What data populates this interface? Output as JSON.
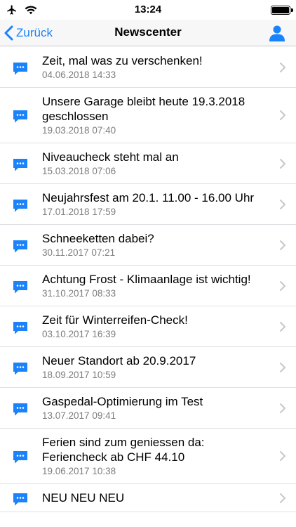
{
  "status_bar": {
    "time": "13:24",
    "icons": [
      "airplane-icon",
      "wifi-icon",
      "battery-icon"
    ],
    "battery_level": 1.0
  },
  "nav": {
    "back_label": "Zurück",
    "title": "Newscenter",
    "right_icon": "profile-icon"
  },
  "colors": {
    "accent": "#1a82fb",
    "secondary_text": "#7d7d82",
    "separator": "#e0e0e4",
    "nav_background": "#f7f7f7"
  },
  "news": [
    {
      "title": "Zeit, mal was zu verschenken!",
      "date": "04.06.2018 14:33"
    },
    {
      "title": "Unsere Garage bleibt heute 19.3.2018 geschlossen",
      "date": "19.03.2018 07:40"
    },
    {
      "title": "Niveaucheck steht mal an",
      "date": "15.03.2018 07:06"
    },
    {
      "title": "Neujahrsfest am 20.1. 11.00 - 16.00 Uhr",
      "date": "17.01.2018 17:59"
    },
    {
      "title": "Schneeketten dabei?",
      "date": "30.11.2017 07:21"
    },
    {
      "title": "Achtung Frost - Klimaanlage ist wichtig!",
      "date": "31.10.2017 08:33"
    },
    {
      "title": "Zeit für Winterreifen-Check!",
      "date": "03.10.2017 16:39"
    },
    {
      "title": "Neuer Standort ab 20.9.2017",
      "date": "18.09.2017 10:59"
    },
    {
      "title": "Gaspedal-Optimierung im Test",
      "date": "13.07.2017 09:41"
    },
    {
      "title": "Ferien sind zum geniessen da: Feriencheck ab CHF 44.10",
      "date": "19.06.2017 10:38"
    },
    {
      "title": "NEU NEU NEU",
      "date": ""
    }
  ]
}
